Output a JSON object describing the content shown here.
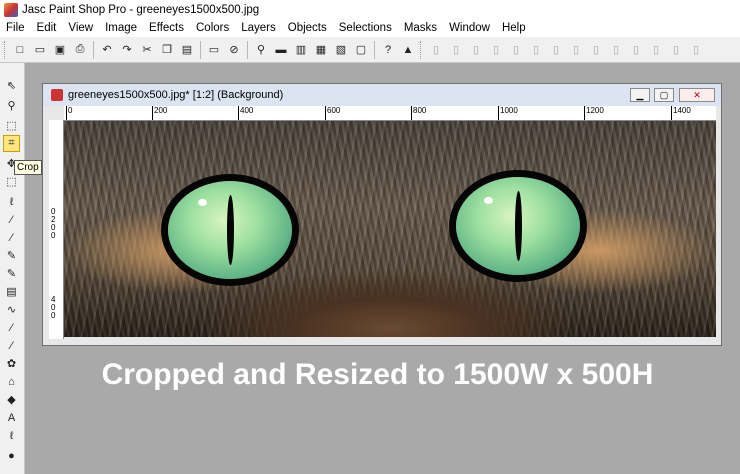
{
  "app": {
    "title": "Jasc Paint Shop Pro - greeneyes1500x500.jpg"
  },
  "menu": [
    "File",
    "Edit",
    "View",
    "Image",
    "Effects",
    "Colors",
    "Layers",
    "Objects",
    "Selections",
    "Masks",
    "Window",
    "Help"
  ],
  "toolbar": {
    "buttons": [
      "new-icon",
      "open-icon",
      "save-icon",
      "print-icon",
      "undo-icon",
      "redo-icon",
      "cut-icon",
      "copy-icon",
      "paste-icon",
      "screen-capture-icon",
      "browse-icon",
      "zoom-icon",
      "overview-icon",
      "histogram-icon",
      "color-palette-icon",
      "layer-palette-icon",
      "tool-options-icon",
      "help-icon",
      "script-icon",
      "layer-new-icon",
      "layer-delete-icon",
      "layer-properties-icon",
      "layer-duplicate-icon",
      "layer-merge-icon",
      "mask-icon",
      "object-icon",
      "selection-icon",
      "frame-icon"
    ]
  },
  "tools": [
    "arrow-tool",
    "zoom-tool",
    "deform-tool",
    "crop-tool",
    "move-tool",
    "selection-tool",
    "freehand-tool",
    "dropper-tool",
    "paint-brush-tool",
    "clone-tool",
    "color-replacer-tool",
    "retouch-tool",
    "scratch-remover-tool",
    "eraser-tool",
    "picture-tube-tool",
    "airbrush-tool",
    "flood-fill-tool",
    "text-tool",
    "draw-tool",
    "preset-shapes-tool"
  ],
  "tooltip": "Crop",
  "document": {
    "title": "greeneyes1500x500.jpg* [1:2] (Background)",
    "ruler_h_labels": [
      "0",
      "200",
      "400",
      "600",
      "800",
      "1000",
      "1200",
      "1400"
    ],
    "ruler_v_labels": [
      "0",
      "2",
      "0",
      "0",
      "4",
      "0",
      "0"
    ]
  },
  "caption": "Cropped and Resized to 1500W x 500H"
}
